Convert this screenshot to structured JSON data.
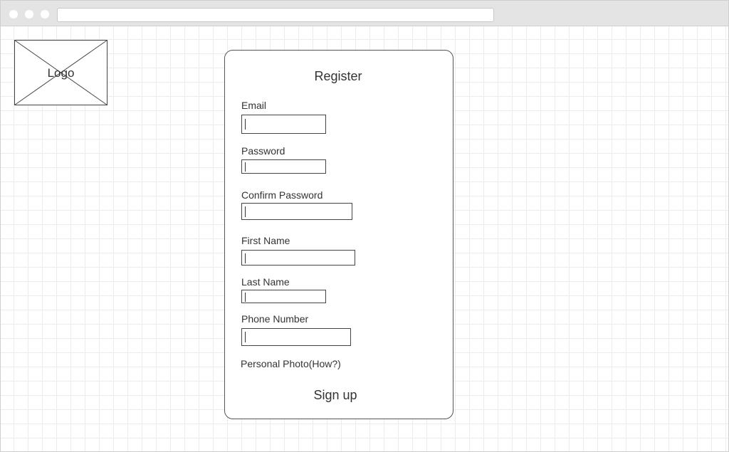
{
  "browser": {
    "address": ""
  },
  "logo": {
    "text": "Logo"
  },
  "form": {
    "title": "Register",
    "fields": [
      {
        "label": "Email",
        "value": ""
      },
      {
        "label": "Password",
        "value": ""
      },
      {
        "label": "Confirm Password",
        "value": ""
      },
      {
        "label": "First Name",
        "value": ""
      },
      {
        "label": "Last Name",
        "value": ""
      },
      {
        "label": "Phone Number",
        "value": ""
      }
    ],
    "photo_label": "Personal Photo(How?)",
    "submit_label": "Sign up"
  }
}
